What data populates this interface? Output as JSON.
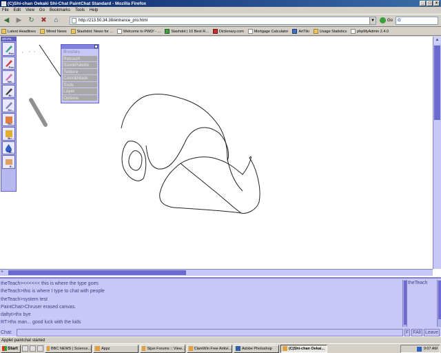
{
  "window": {
    "title": "(C)Shi-chan Oekaki Shi-Chat PaintChat Standard - Mozilla Firefox"
  },
  "menu": [
    "File",
    "Edit",
    "View",
    "Go",
    "Bookmarks",
    "Tools",
    "Help"
  ],
  "nav": {
    "url": "http://213.50.34.38/entrance_pro.html",
    "go_label": "Go",
    "search_glyph": "G"
  },
  "bookmarks": [
    "Latest Headlines",
    "Wired News",
    "Slashdot: News for ...",
    "Welcome to PWD! - ...",
    "Slashdot | 10 Best R...",
    "Dictionary.com",
    "Mortgage Calculator",
    "ArtTiki",
    "Usage Statistics",
    "phpMyAdmin 2.4.0"
  ],
  "toolbar": {
    "header": "Shi-Pa",
    "tools": [
      {
        "name": "pen",
        "label": "Pen"
      },
      {
        "name": "pencil",
        "label": "Pen"
      },
      {
        "name": "water",
        "label": "Wa..."
      },
      {
        "name": "brush",
        "label": "Br..."
      },
      {
        "name": "soft",
        "label": "So..."
      },
      {
        "name": "dodge",
        "label": "Do..."
      },
      {
        "name": "burn",
        "label": "Bu..."
      },
      {
        "name": "blur",
        "label": "Bl..."
      },
      {
        "name": "eraser",
        "label": "E..."
      }
    ]
  },
  "palette": {
    "items": [
      "Brushes",
      "Retouch",
      "Size&Palette",
      "Texture",
      "Color&Mask",
      "Tools",
      "Layer",
      "Options"
    ]
  },
  "chat": {
    "lines": [
      "theTeach><<<<<< this is where the type goes",
      "theTeach>this is where I type to chat with people",
      "theTeach>system test",
      "PaintChat>Chruser erased canvas.",
      "daftyt>thx bye",
      "RT>thx man... good luck with the kids"
    ],
    "users": [
      "theTeach"
    ],
    "input_label": "Chat:",
    "buttons": [
      "F",
      "FAll",
      "Leave"
    ]
  },
  "status": {
    "text": "Applet paintchat started"
  },
  "taskbar": {
    "start_label": "Start",
    "tasks": [
      {
        "label": "BBC NEWS | Science...",
        "active": false
      },
      {
        "label": "Appz",
        "active": false
      },
      {
        "label": "Sijun Forums :: View...",
        "active": false
      },
      {
        "label": "ClamWin Free Antivi...",
        "active": false
      },
      {
        "label": "Adobe Photoshop",
        "active": false
      },
      {
        "label": "(C)Shi-chan Oekai...",
        "active": true
      }
    ],
    "clock": "9:07 AM"
  }
}
